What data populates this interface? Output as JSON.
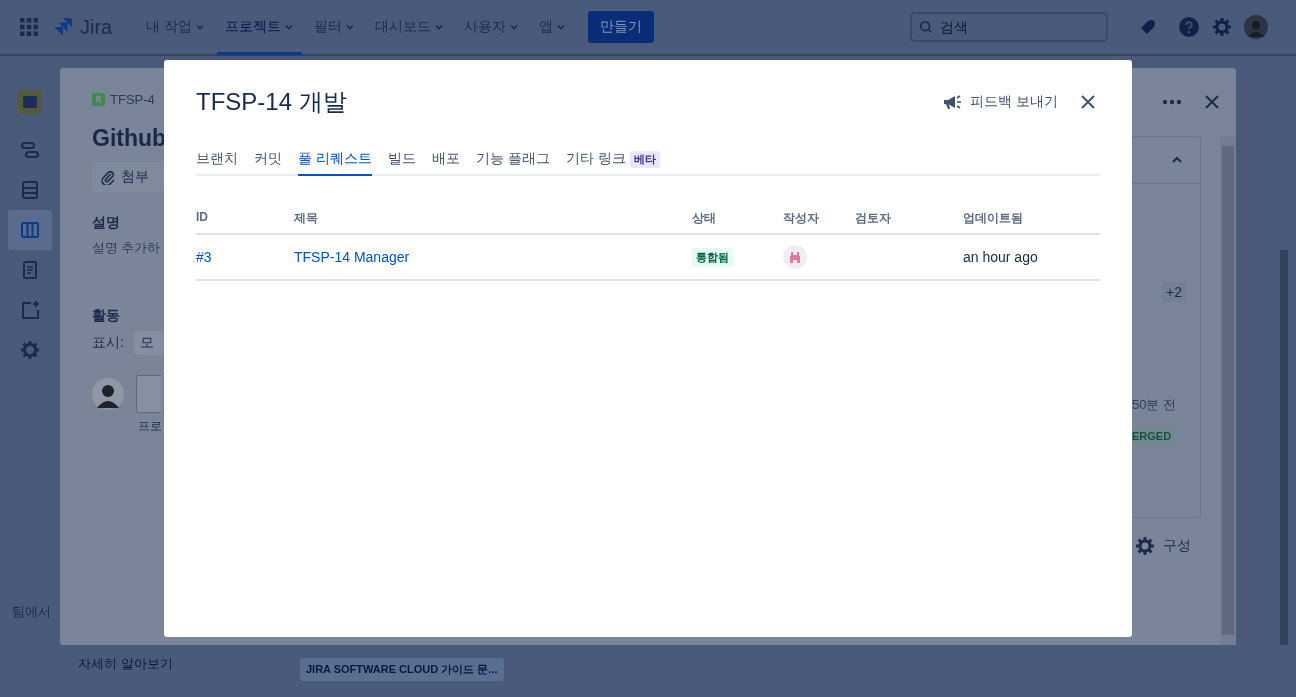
{
  "top_nav": {
    "product": "Jira",
    "menus": [
      {
        "label": "내 작업",
        "selected": false
      },
      {
        "label": "프로젝트",
        "selected": true
      },
      {
        "label": "필터",
        "selected": false
      },
      {
        "label": "대시보드",
        "selected": false
      },
      {
        "label": "사용자",
        "selected": false
      },
      {
        "label": "앱",
        "selected": false
      }
    ],
    "create_button": "만들기",
    "search": {
      "placeholder": "검색"
    }
  },
  "project_sidebar": {
    "items": [
      {
        "kind": "timeline",
        "selected": false
      },
      {
        "kind": "backlog",
        "selected": false
      },
      {
        "kind": "board",
        "selected": true
      },
      {
        "kind": "page",
        "selected": false
      },
      {
        "kind": "shortcut",
        "selected": false
      },
      {
        "kind": "settings",
        "selected": false
      }
    ],
    "footer_text": "팀에서",
    "learn_more": "자세히 알아보기"
  },
  "guide_tag": "JIRA SOFTWARE CLOUD 가이드 문...",
  "issue_panel": {
    "key": "TFSP-4",
    "title": "Github",
    "attach_button": "첨부",
    "description_label": "설명",
    "description_placeholder": "설명 추가하",
    "activity_label": "활동",
    "show_label": "표시:",
    "show_value": "모",
    "comment_hint": "프로",
    "extra_count": "+2",
    "time": "50분 전",
    "status": "ERGED",
    "configure": "구성"
  },
  "modal": {
    "title": "TFSP-14 개발",
    "feedback": "피드백 보내기",
    "tabs": [
      {
        "label": "브랜치",
        "selected": false
      },
      {
        "label": "커밋",
        "selected": false
      },
      {
        "label": "풀 리퀘스트",
        "selected": true
      },
      {
        "label": "빌드",
        "selected": false
      },
      {
        "label": "배포",
        "selected": false
      },
      {
        "label": "기능 플래그",
        "selected": false
      },
      {
        "label": "기타 링크",
        "selected": false,
        "badge": "베타"
      }
    ],
    "table": {
      "columns": [
        "ID",
        "제목",
        "상태",
        "작성자",
        "검토자",
        "업데이트됨"
      ],
      "rows": [
        {
          "id": "#3",
          "title": "TFSP-14 Manager",
          "status": "통합됨",
          "updated": "an hour ago"
        }
      ]
    }
  }
}
